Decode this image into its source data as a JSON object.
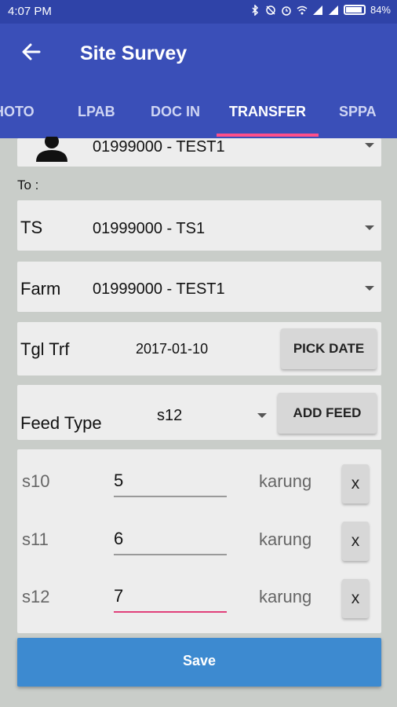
{
  "status_bar": {
    "time": "4:07 PM",
    "battery": "84%",
    "icons": [
      "bluetooth-icon",
      "silent-icon",
      "alarm-icon",
      "wifi-icon",
      "signal-icon",
      "signal-icon",
      "battery-icon"
    ]
  },
  "app_bar": {
    "title": "Site Survey",
    "tabs": [
      {
        "label": "HOTO",
        "active": false
      },
      {
        "label": "LPAB",
        "active": false
      },
      {
        "label": "DOC IN",
        "active": false
      },
      {
        "label": "TRANSFER",
        "active": true
      },
      {
        "label": "SPPA",
        "active": false
      }
    ]
  },
  "from_card": {
    "value": "01999000 - TEST1"
  },
  "to_label": "To :",
  "ts_card": {
    "label": "TS",
    "value": "01999000 - TS1"
  },
  "farm_card": {
    "label": "Farm",
    "value": "01999000 - TEST1"
  },
  "date_card": {
    "label": "Tgl Trf",
    "value": "2017-01-10",
    "button": "PICK DATE"
  },
  "feed_card": {
    "label": "Feed Type",
    "selected": "s12",
    "button": "ADD FEED"
  },
  "feed_items": [
    {
      "name": "s10",
      "quantity": "5",
      "unit": "karung",
      "remove": "x",
      "focused": false
    },
    {
      "name": "s11",
      "quantity": "6",
      "unit": "karung",
      "remove": "x",
      "focused": false
    },
    {
      "name": "s12",
      "quantity": "7",
      "unit": "karung",
      "remove": "x",
      "focused": true
    }
  ],
  "save_label": "Save",
  "colors": {
    "primary": "#3a4fb8",
    "status_bar": "#2f43a8",
    "accent": "#ff4f8a",
    "save": "#3d8ad0"
  }
}
